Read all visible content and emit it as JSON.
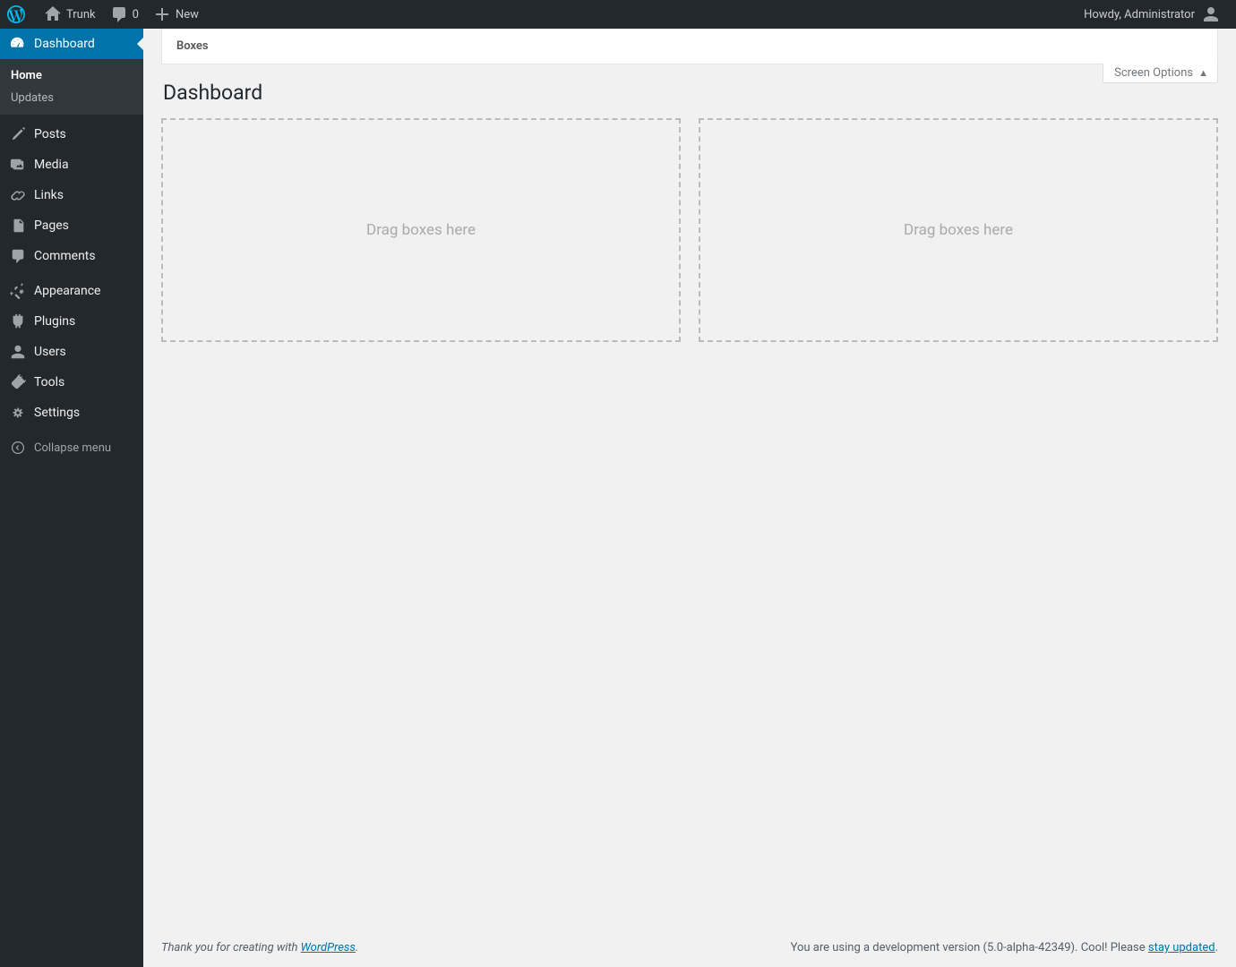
{
  "adminbar": {
    "site_name": "Trunk",
    "comments_count": "0",
    "new_label": "New",
    "howdy": "Howdy, Administrator"
  },
  "sidebar": {
    "items": [
      {
        "label": "Dashboard",
        "icon": "dashboard",
        "current": true,
        "submenu": [
          {
            "label": "Home",
            "current": true
          },
          {
            "label": "Updates",
            "current": false
          }
        ]
      },
      {
        "label": "Posts",
        "icon": "posts"
      },
      {
        "label": "Media",
        "icon": "media"
      },
      {
        "label": "Links",
        "icon": "links"
      },
      {
        "label": "Pages",
        "icon": "pages"
      },
      {
        "label": "Comments",
        "icon": "comments"
      },
      {
        "label": "Appearance",
        "icon": "appearance"
      },
      {
        "label": "Plugins",
        "icon": "plugins"
      },
      {
        "label": "Users",
        "icon": "users"
      },
      {
        "label": "Tools",
        "icon": "tools"
      },
      {
        "label": "Settings",
        "icon": "settings"
      }
    ],
    "collapse_label": "Collapse menu"
  },
  "content": {
    "boxes_tab": "Boxes",
    "screen_options": "Screen Options",
    "heading": "Dashboard",
    "drag_placeholder": "Drag boxes here"
  },
  "footer": {
    "thank_you_prefix": "Thank you for creating with ",
    "wp_link": "WordPress",
    "version_prefix": "You are using a development version (5.0-alpha-42349). Cool! Please ",
    "update_link": "stay updated",
    "period": "."
  }
}
